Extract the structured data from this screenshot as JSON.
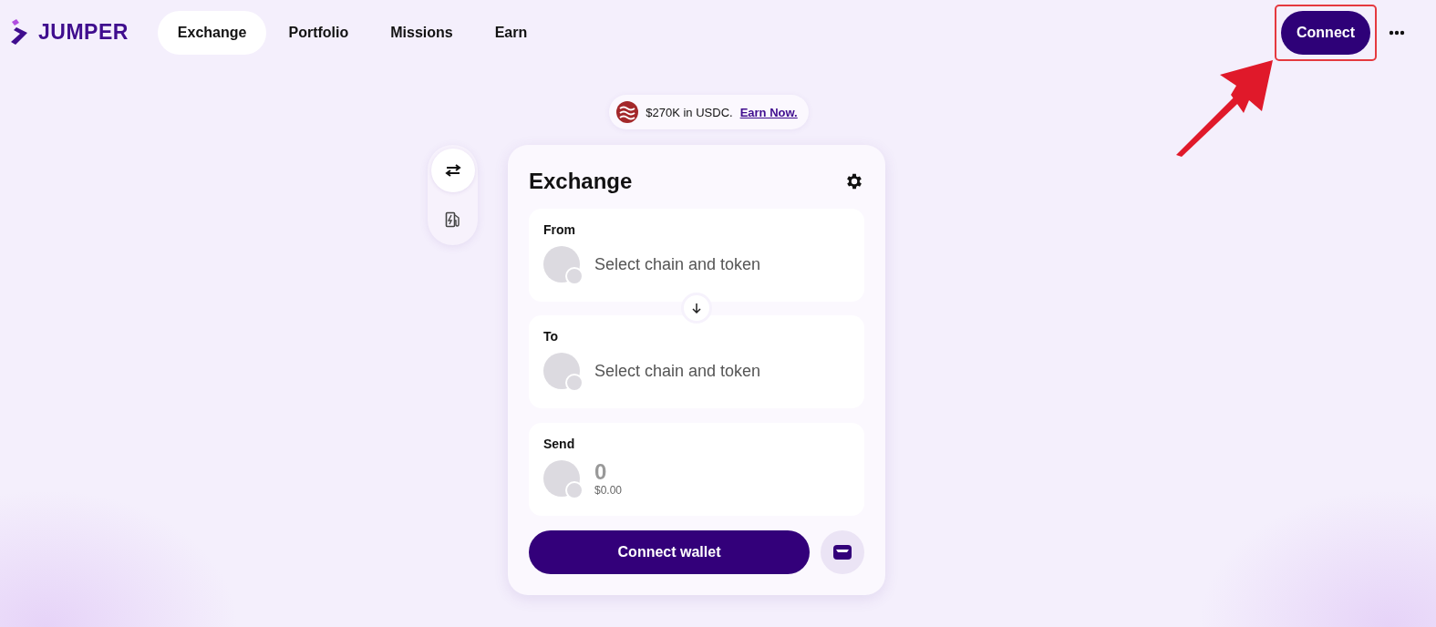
{
  "brand": {
    "name": "JUMPER"
  },
  "nav": {
    "tabs": [
      {
        "label": "Exchange",
        "selected": true
      },
      {
        "label": "Portfolio",
        "selected": false
      },
      {
        "label": "Missions",
        "selected": false
      },
      {
        "label": "Earn",
        "selected": false
      }
    ]
  },
  "connect_button": {
    "label": "Connect",
    "highlighted": true
  },
  "promo": {
    "text": "$270K in USDC.",
    "link": "Earn Now."
  },
  "side_rail": {
    "items": [
      {
        "kind": "exchange",
        "selected": true
      },
      {
        "kind": "gas",
        "selected": false
      }
    ]
  },
  "exchange_card": {
    "title": "Exchange",
    "fields": [
      {
        "label": "From",
        "prompt": "Select chain and token"
      },
      {
        "label": "To",
        "prompt": "Select chain and token"
      }
    ],
    "send": {
      "label": "Send",
      "amount": "0",
      "value": "$0.00"
    },
    "primary_button": "Connect wallet"
  }
}
